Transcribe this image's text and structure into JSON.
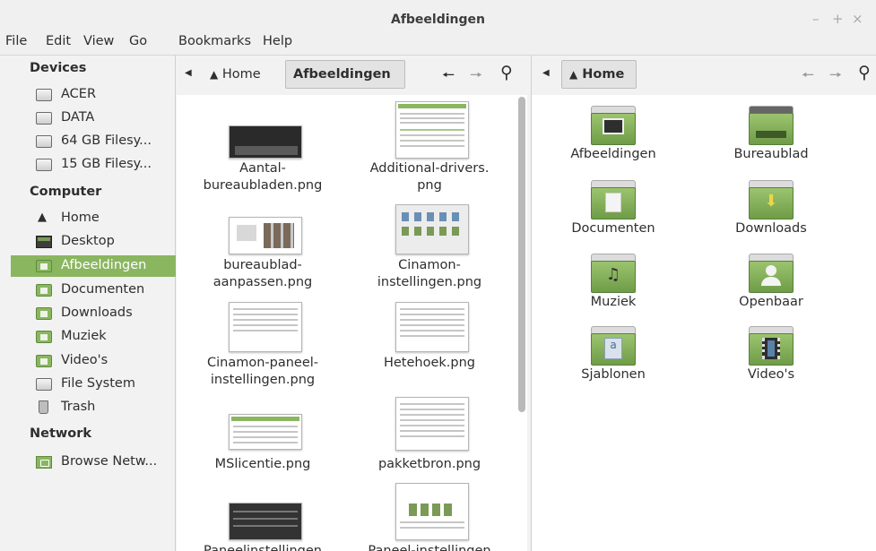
{
  "window": {
    "title": "Afbeeldingen",
    "controls": [
      "–",
      "+",
      "×"
    ]
  },
  "menubar": [
    "File",
    "Edit",
    "View",
    "Go",
    "Bookmarks",
    "Help"
  ],
  "sidebar": {
    "devices_heading": "Devices",
    "devices": [
      "ACER",
      "DATA",
      "64 GB Filesy...",
      "15 GB Filesy..."
    ],
    "computer_heading": "Computer",
    "computer": [
      "Home",
      "Desktop",
      "Afbeeldingen",
      "Documenten",
      "Downloads",
      "Muziek",
      "Video's",
      "File System",
      "Trash"
    ],
    "selected": "Afbeeldingen",
    "network_heading": "Network",
    "network": [
      "Browse Netw..."
    ]
  },
  "left_pane": {
    "breadcrumb": [
      "Home",
      "Afbeeldingen"
    ],
    "files": [
      {
        "line1": "Aantal-",
        "line2": "bureaubladen.png"
      },
      {
        "line1": "Additional-drivers.",
        "line2": "png"
      },
      {
        "line1": "bureaublad-",
        "line2": "aanpassen.png"
      },
      {
        "line1": "Cinamon-",
        "line2": "instellingen.png"
      },
      {
        "line1": "Cinamon-paneel-",
        "line2": "instellingen.png"
      },
      {
        "line1": "Hetehoek.png",
        "line2": ""
      },
      {
        "line1": "MSlicentie.png",
        "line2": ""
      },
      {
        "line1": "pakketbron.png",
        "line2": ""
      },
      {
        "line1": "Paneelinstellingen",
        "line2": ""
      },
      {
        "line1": "Paneel-instellingen",
        "line2": ""
      }
    ]
  },
  "right_pane": {
    "breadcrumb": [
      "Home"
    ],
    "folders": [
      "Afbeeldingen",
      "Bureaublad",
      "Documenten",
      "Downloads",
      "Muziek",
      "Openbaar",
      "Sjablonen",
      "Video's"
    ]
  },
  "colors": {
    "accent": "#8ab660",
    "folder_green": "#8ab660"
  }
}
